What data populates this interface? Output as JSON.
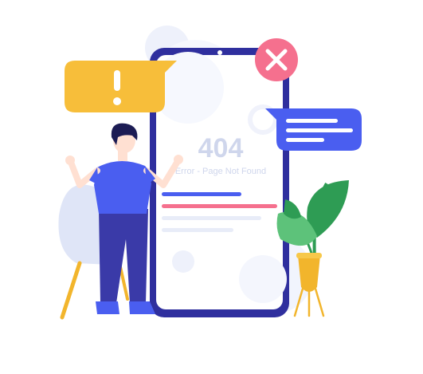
{
  "error": {
    "code": "404",
    "message": "Error - Page Not Found"
  },
  "icons": {
    "alert": "exclamation-icon",
    "close": "close-icon",
    "message": "chat-bubble-icon"
  },
  "colors": {
    "phone_frame": "#2f2f9e",
    "primary_blue": "#4a5ef0",
    "alert_yellow": "#f7be3a",
    "error_red": "#f5708e",
    "plant_green": "#2e9c54",
    "pot_yellow": "#f2b52c"
  }
}
